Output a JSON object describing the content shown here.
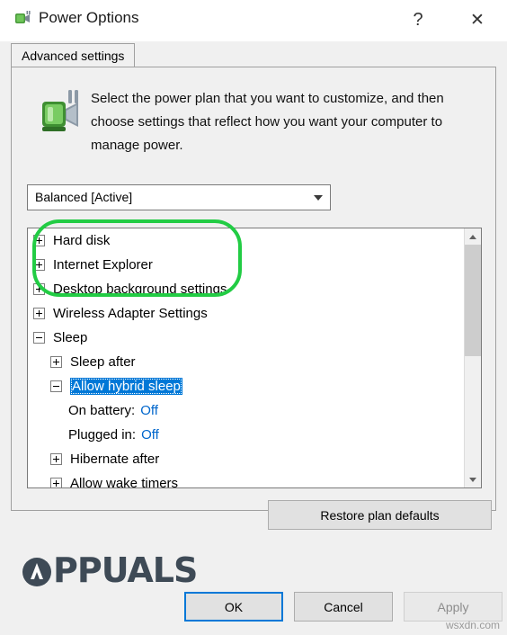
{
  "window": {
    "title": "Power Options",
    "icon": "plug-battery-icon",
    "help_label": "?",
    "close_label": "✕"
  },
  "tabs": [
    {
      "label": "Advanced settings",
      "name": "tab-advanced-settings",
      "selected": true
    }
  ],
  "header": {
    "description": "Select the power plan that you want to customize, and then choose settings that reflect how you want your computer to manage power.",
    "icon": "power-plug-icon"
  },
  "plan_combo": {
    "value": "Balanced [Active]",
    "arrow": "chevron-down-icon"
  },
  "settings_list": [
    {
      "label": "Hard disk",
      "expander": "plus",
      "indent": 1
    },
    {
      "label": "Internet Explorer",
      "expander": "plus",
      "indent": 1
    },
    {
      "label": "Desktop background settings",
      "expander": "plus",
      "indent": 1
    },
    {
      "label": "Wireless Adapter Settings",
      "expander": "plus",
      "indent": 1
    },
    {
      "label": "Sleep",
      "expander": "minus",
      "indent": 1
    },
    {
      "label": "Sleep after",
      "expander": "plus",
      "indent": 2
    },
    {
      "label": "Allow hybrid sleep",
      "expander": "minus",
      "indent": 2,
      "selected": true
    },
    {
      "label": "On battery:",
      "value": "Off",
      "indent": 3
    },
    {
      "label": "Plugged in:",
      "value": "Off",
      "indent": 3
    },
    {
      "label": "Hibernate after",
      "expander": "plus",
      "indent": 2
    },
    {
      "label": "Allow wake timers",
      "expander": "plus",
      "indent": 2
    }
  ],
  "scrollbar": {
    "up_arrow": "scroll-up-icon",
    "down_arrow": "scroll-down-icon"
  },
  "restore_button": {
    "label": "Restore plan defaults"
  },
  "footer_buttons": {
    "ok": "OK",
    "cancel": "Cancel",
    "apply": "Apply"
  },
  "watermarks": {
    "brand": "PPUALS",
    "site": "wsxdn.com"
  },
  "colors": {
    "selection": "#0078d7",
    "value_text": "#0066cc",
    "highlight_ring": "#22cc44"
  }
}
